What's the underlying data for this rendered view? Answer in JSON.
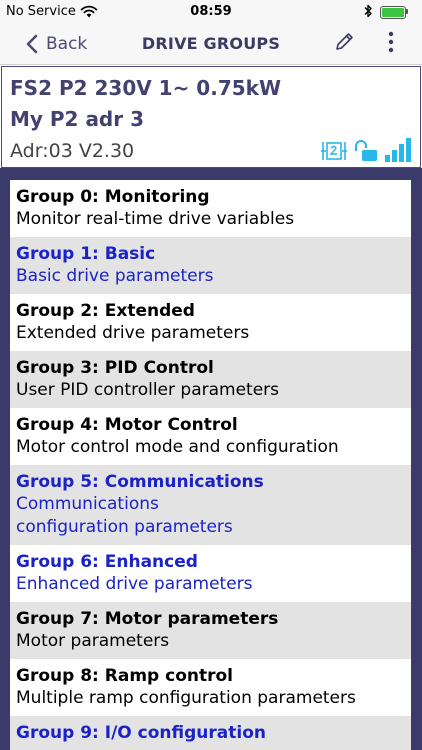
{
  "status_bar": {
    "carrier": "No Service",
    "time": "08:59"
  },
  "nav": {
    "back_label": "Back",
    "title": "DRIVE GROUPS"
  },
  "drive": {
    "model": "FS2 P2 230V 1~ 0.75kW",
    "name": "My P2 adr 3",
    "address_version": "Adr:03 V2.30"
  },
  "colors": {
    "accent_navy": "#3b3b6b",
    "link_blue": "#1a22c8",
    "icon_cyan": "#29b6e8"
  },
  "groups": [
    {
      "title": "Group 0: Monitoring",
      "desc": "Monitor real-time drive variables",
      "style": "black"
    },
    {
      "title": "Group 1: Basic",
      "desc": "Basic drive parameters",
      "style": "blue"
    },
    {
      "title": "Group 2: Extended",
      "desc": "Extended drive parameters",
      "style": "black"
    },
    {
      "title": "Group 3: PID Control",
      "desc": "User PID controller parameters",
      "style": "black"
    },
    {
      "title": "Group 4: Motor Control",
      "desc": "Motor control mode and configuration",
      "style": "black"
    },
    {
      "title": "Group 5: Communications",
      "desc": "Communications\nconfiguration parameters",
      "style": "blue"
    },
    {
      "title": "Group 6: Enhanced",
      "desc": "Enhanced drive parameters",
      "style": "blue"
    },
    {
      "title": "Group 7: Motor parameters",
      "desc": "Motor parameters",
      "style": "black"
    },
    {
      "title": "Group 8: Ramp control",
      "desc": "Multiple ramp configuration parameters",
      "style": "black"
    },
    {
      "title": "Group 9: I/O configuration",
      "desc": "",
      "style": "blue"
    }
  ]
}
